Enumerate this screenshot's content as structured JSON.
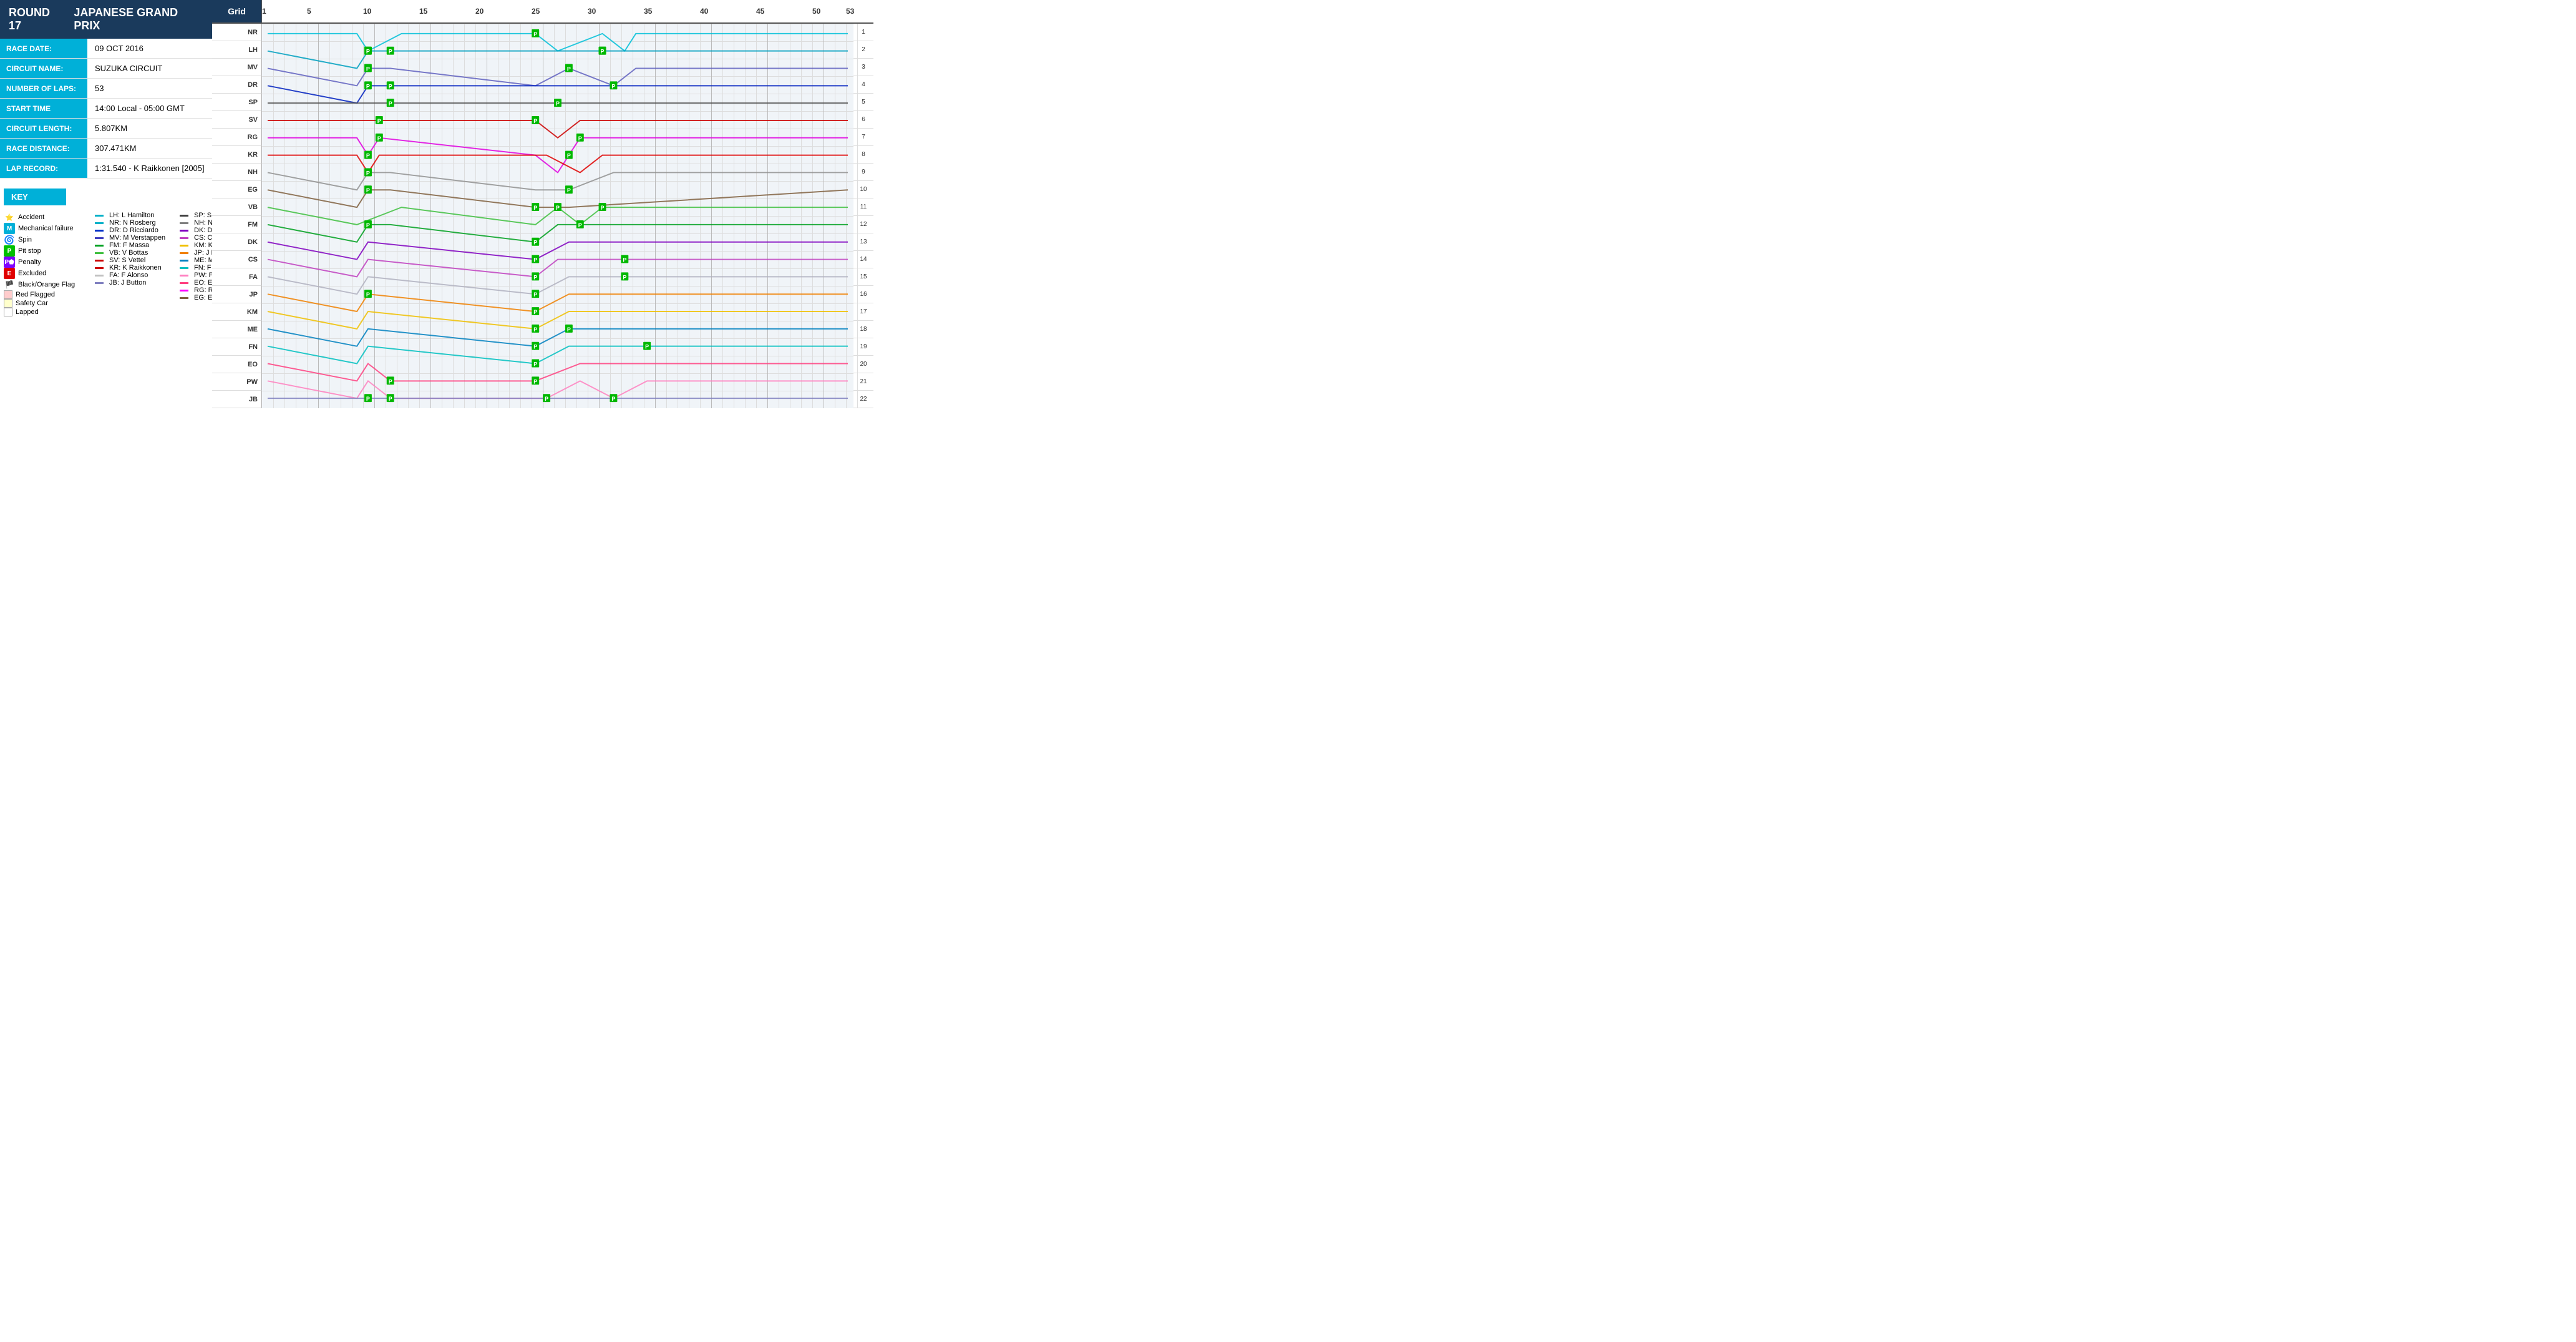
{
  "header": {
    "round": "ROUND 17",
    "race_name": "JAPANESE GRAND PRIX"
  },
  "race_info": [
    {
      "label": "RACE DATE:",
      "value": "09 OCT 2016"
    },
    {
      "label": "CIRCUIT NAME:",
      "value": "SUZUKA CIRCUIT"
    },
    {
      "label": "NUMBER OF LAPS:",
      "value": "53"
    },
    {
      "label": "START TIME",
      "value": "14:00 Local - 05:00 GMT"
    },
    {
      "label": "CIRCUIT LENGTH:",
      "value": "5.807KM"
    },
    {
      "label": "RACE DISTANCE:",
      "value": "307.471KM"
    },
    {
      "label": "LAP RECORD:",
      "value": "1:31.540 - K Raikkonen [2005]"
    }
  ],
  "key_header": "KEY",
  "key_symbols": [
    {
      "icon": "star",
      "label": "Accident"
    },
    {
      "icon": "M",
      "label": "Mechanical failure"
    },
    {
      "icon": "spin",
      "label": "Spin"
    },
    {
      "icon": "P",
      "label": "Pit stop"
    },
    {
      "icon": "Pstar",
      "label": "Penalty"
    },
    {
      "icon": "E",
      "label": "Excluded"
    },
    {
      "icon": "flag",
      "label": "Black/Orange Flag"
    },
    {
      "icon": "red",
      "label": "Red Flagged"
    },
    {
      "icon": "yellow",
      "label": "Safety Car"
    },
    {
      "icon": "white",
      "label": "Lapped"
    }
  ],
  "key_drivers_col1": [
    {
      "color": "#00b0c8",
      "label": "LH: L Hamilton"
    },
    {
      "color": "#00b0c8",
      "label": "NR: N Rosberg"
    },
    {
      "color": "#0030c8",
      "label": "DR: D Ricciardo"
    },
    {
      "color": "#4040c0",
      "label": "MV: M Verstappen"
    },
    {
      "color": "#00a020",
      "label": "FM: F Massa"
    },
    {
      "color": "#40c040",
      "label": "VB: V Bottas"
    },
    {
      "color": "#cc0000",
      "label": "SV: S Vettel"
    },
    {
      "color": "#cc0000",
      "label": "KR: K Raikkonen"
    },
    {
      "color": "#c0c0c0",
      "label": "FA: F Alonso"
    },
    {
      "color": "#8080c0",
      "label": "JB: J Button"
    }
  ],
  "key_drivers_col2": [
    {
      "color": "#404040",
      "label": "SP: S Perez"
    },
    {
      "color": "#808080",
      "label": "NH: N Hulkenberg"
    },
    {
      "color": "#8000c0",
      "label": "DK: D Kvyat"
    },
    {
      "color": "#c040c0",
      "label": "CS: C Sainz"
    },
    {
      "color": "#f0c000",
      "label": "KM: K Magnussen"
    },
    {
      "color": "#f08000",
      "label": "JP: J Palmer"
    },
    {
      "color": "#0080c0",
      "label": "ME: M Ericsson"
    },
    {
      "color": "#00c0c0",
      "label": "FN: F Nasr"
    },
    {
      "color": "#ff80c0",
      "label": "PW: P Wehrlein"
    },
    {
      "color": "#ff4080",
      "label": "EO: E Ocon"
    },
    {
      "color": "#ff00ff",
      "label": "RG: R Grosjean"
    },
    {
      "color": "#806040",
      "label": "EG: E Guiterrez"
    }
  ],
  "grid_label": "Grid",
  "lap_labels": [
    1,
    5,
    10,
    15,
    20,
    25,
    30,
    35,
    40,
    45,
    50,
    53
  ],
  "rows": [
    "NR",
    "LH",
    "MV",
    "DR",
    "SP",
    "SV",
    "RG",
    "KR",
    "NH",
    "EG",
    "VB",
    "FM",
    "DK",
    "CS",
    "FA",
    "JP",
    "KM",
    "ME",
    "FN",
    "EO",
    "PW",
    "JB"
  ],
  "total_laps": 53,
  "total_rows": 22
}
